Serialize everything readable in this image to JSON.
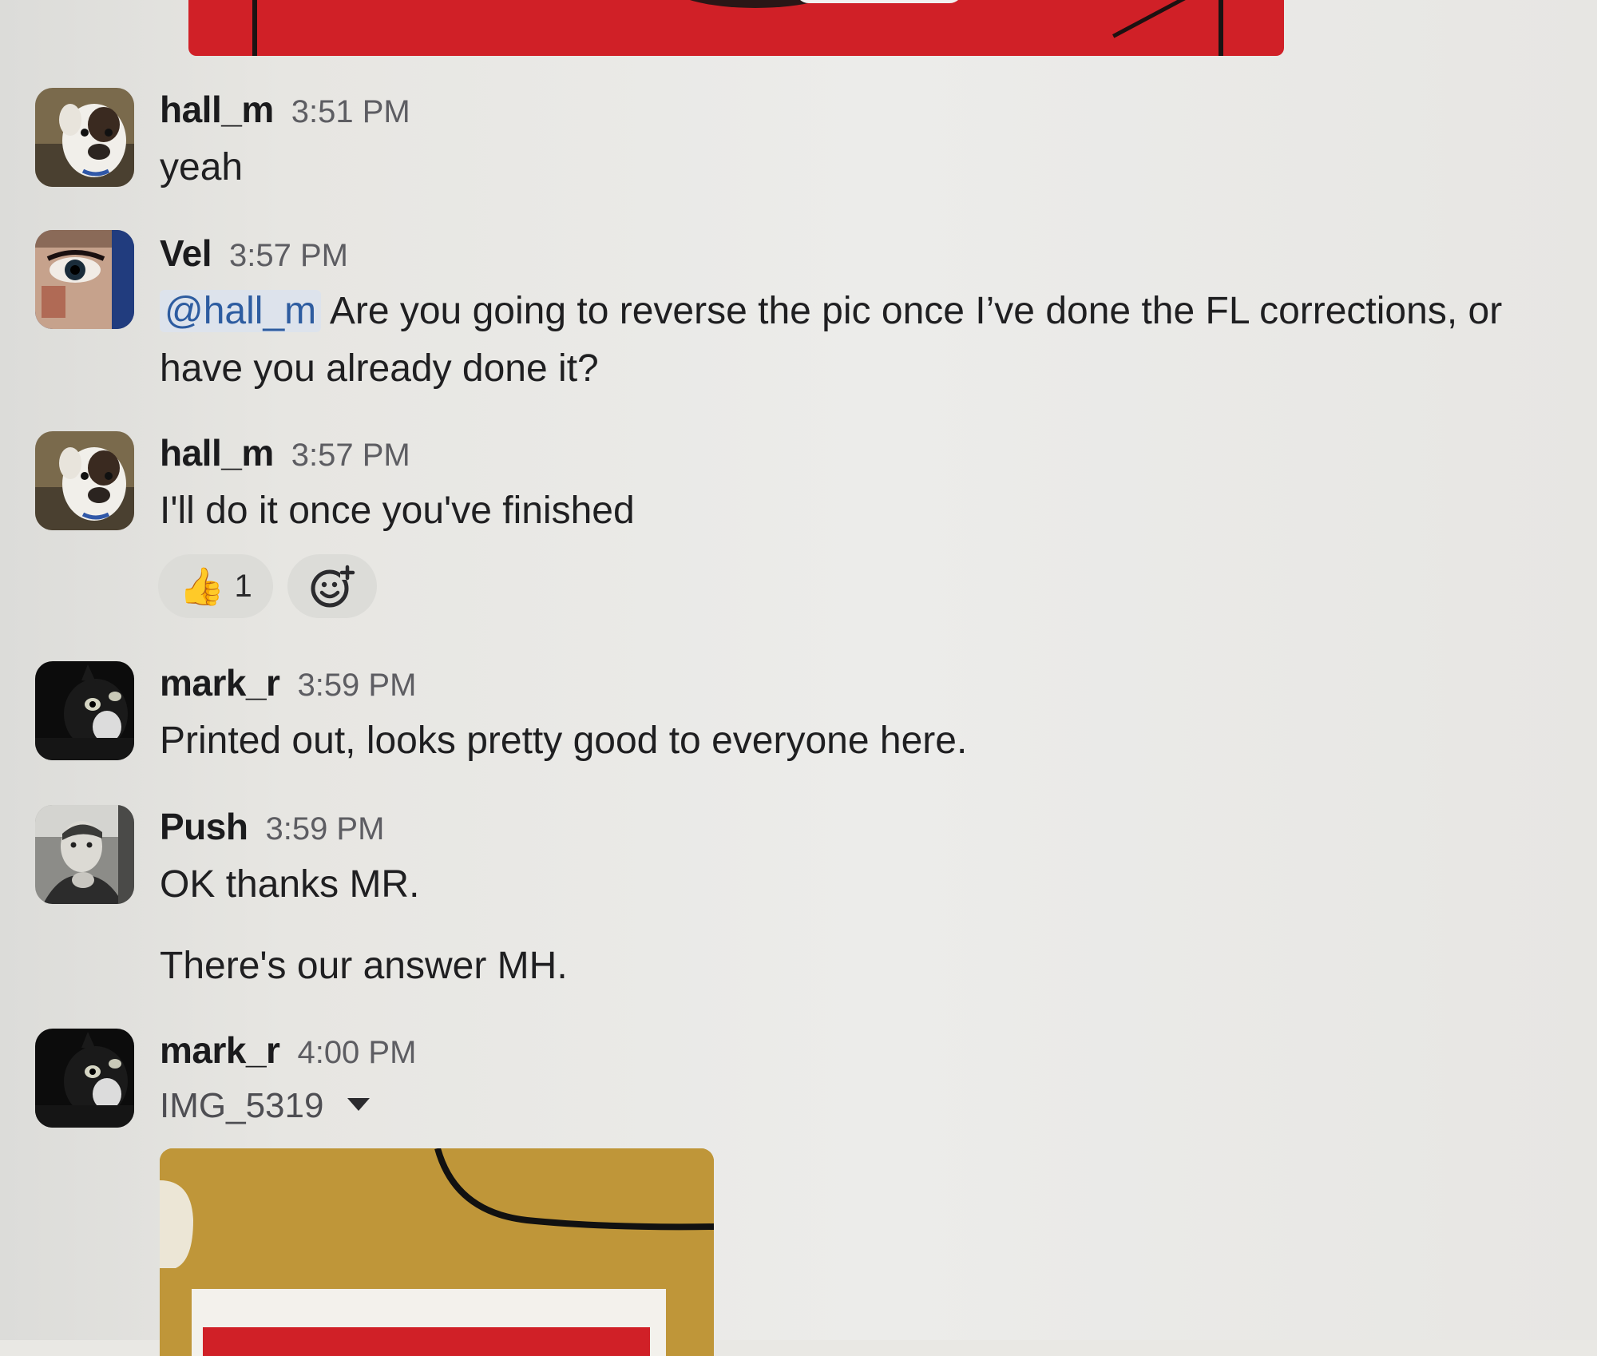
{
  "messages": [
    {
      "username": "hall_m",
      "time": "3:51 PM",
      "text": "yeah"
    },
    {
      "username": "Vel",
      "time": "3:57 PM",
      "mention": "@hall_m",
      "text_line1": "Are you going to reverse the pic once I’ve done the FL corrections, or",
      "text_line2": "have you already done it?"
    },
    {
      "username": "hall_m",
      "time": "3:57 PM",
      "text": "I'll do it once you've finished",
      "reactions": [
        {
          "emoji": "👍",
          "count": "1"
        }
      ]
    },
    {
      "username": "mark_r",
      "time": "3:59 PM",
      "text": "Printed out, looks pretty good to everyone here."
    },
    {
      "username": "Push",
      "time": "3:59 PM",
      "text_line1": "OK thanks MR.",
      "text_line2": "There's our answer MH."
    },
    {
      "username": "mark_r",
      "time": "4:00 PM",
      "file_name": "IMG_5319"
    }
  ],
  "icons": {
    "add_reaction": "add-reaction-icon",
    "dropdown": "caret-down-icon"
  },
  "colors": {
    "background": "#e9e8e4",
    "mention_bg": "#dde3ec",
    "mention_text": "#2d5ca0",
    "attachment_red": "#d02027",
    "attachment_gold": "#c39a3a"
  }
}
